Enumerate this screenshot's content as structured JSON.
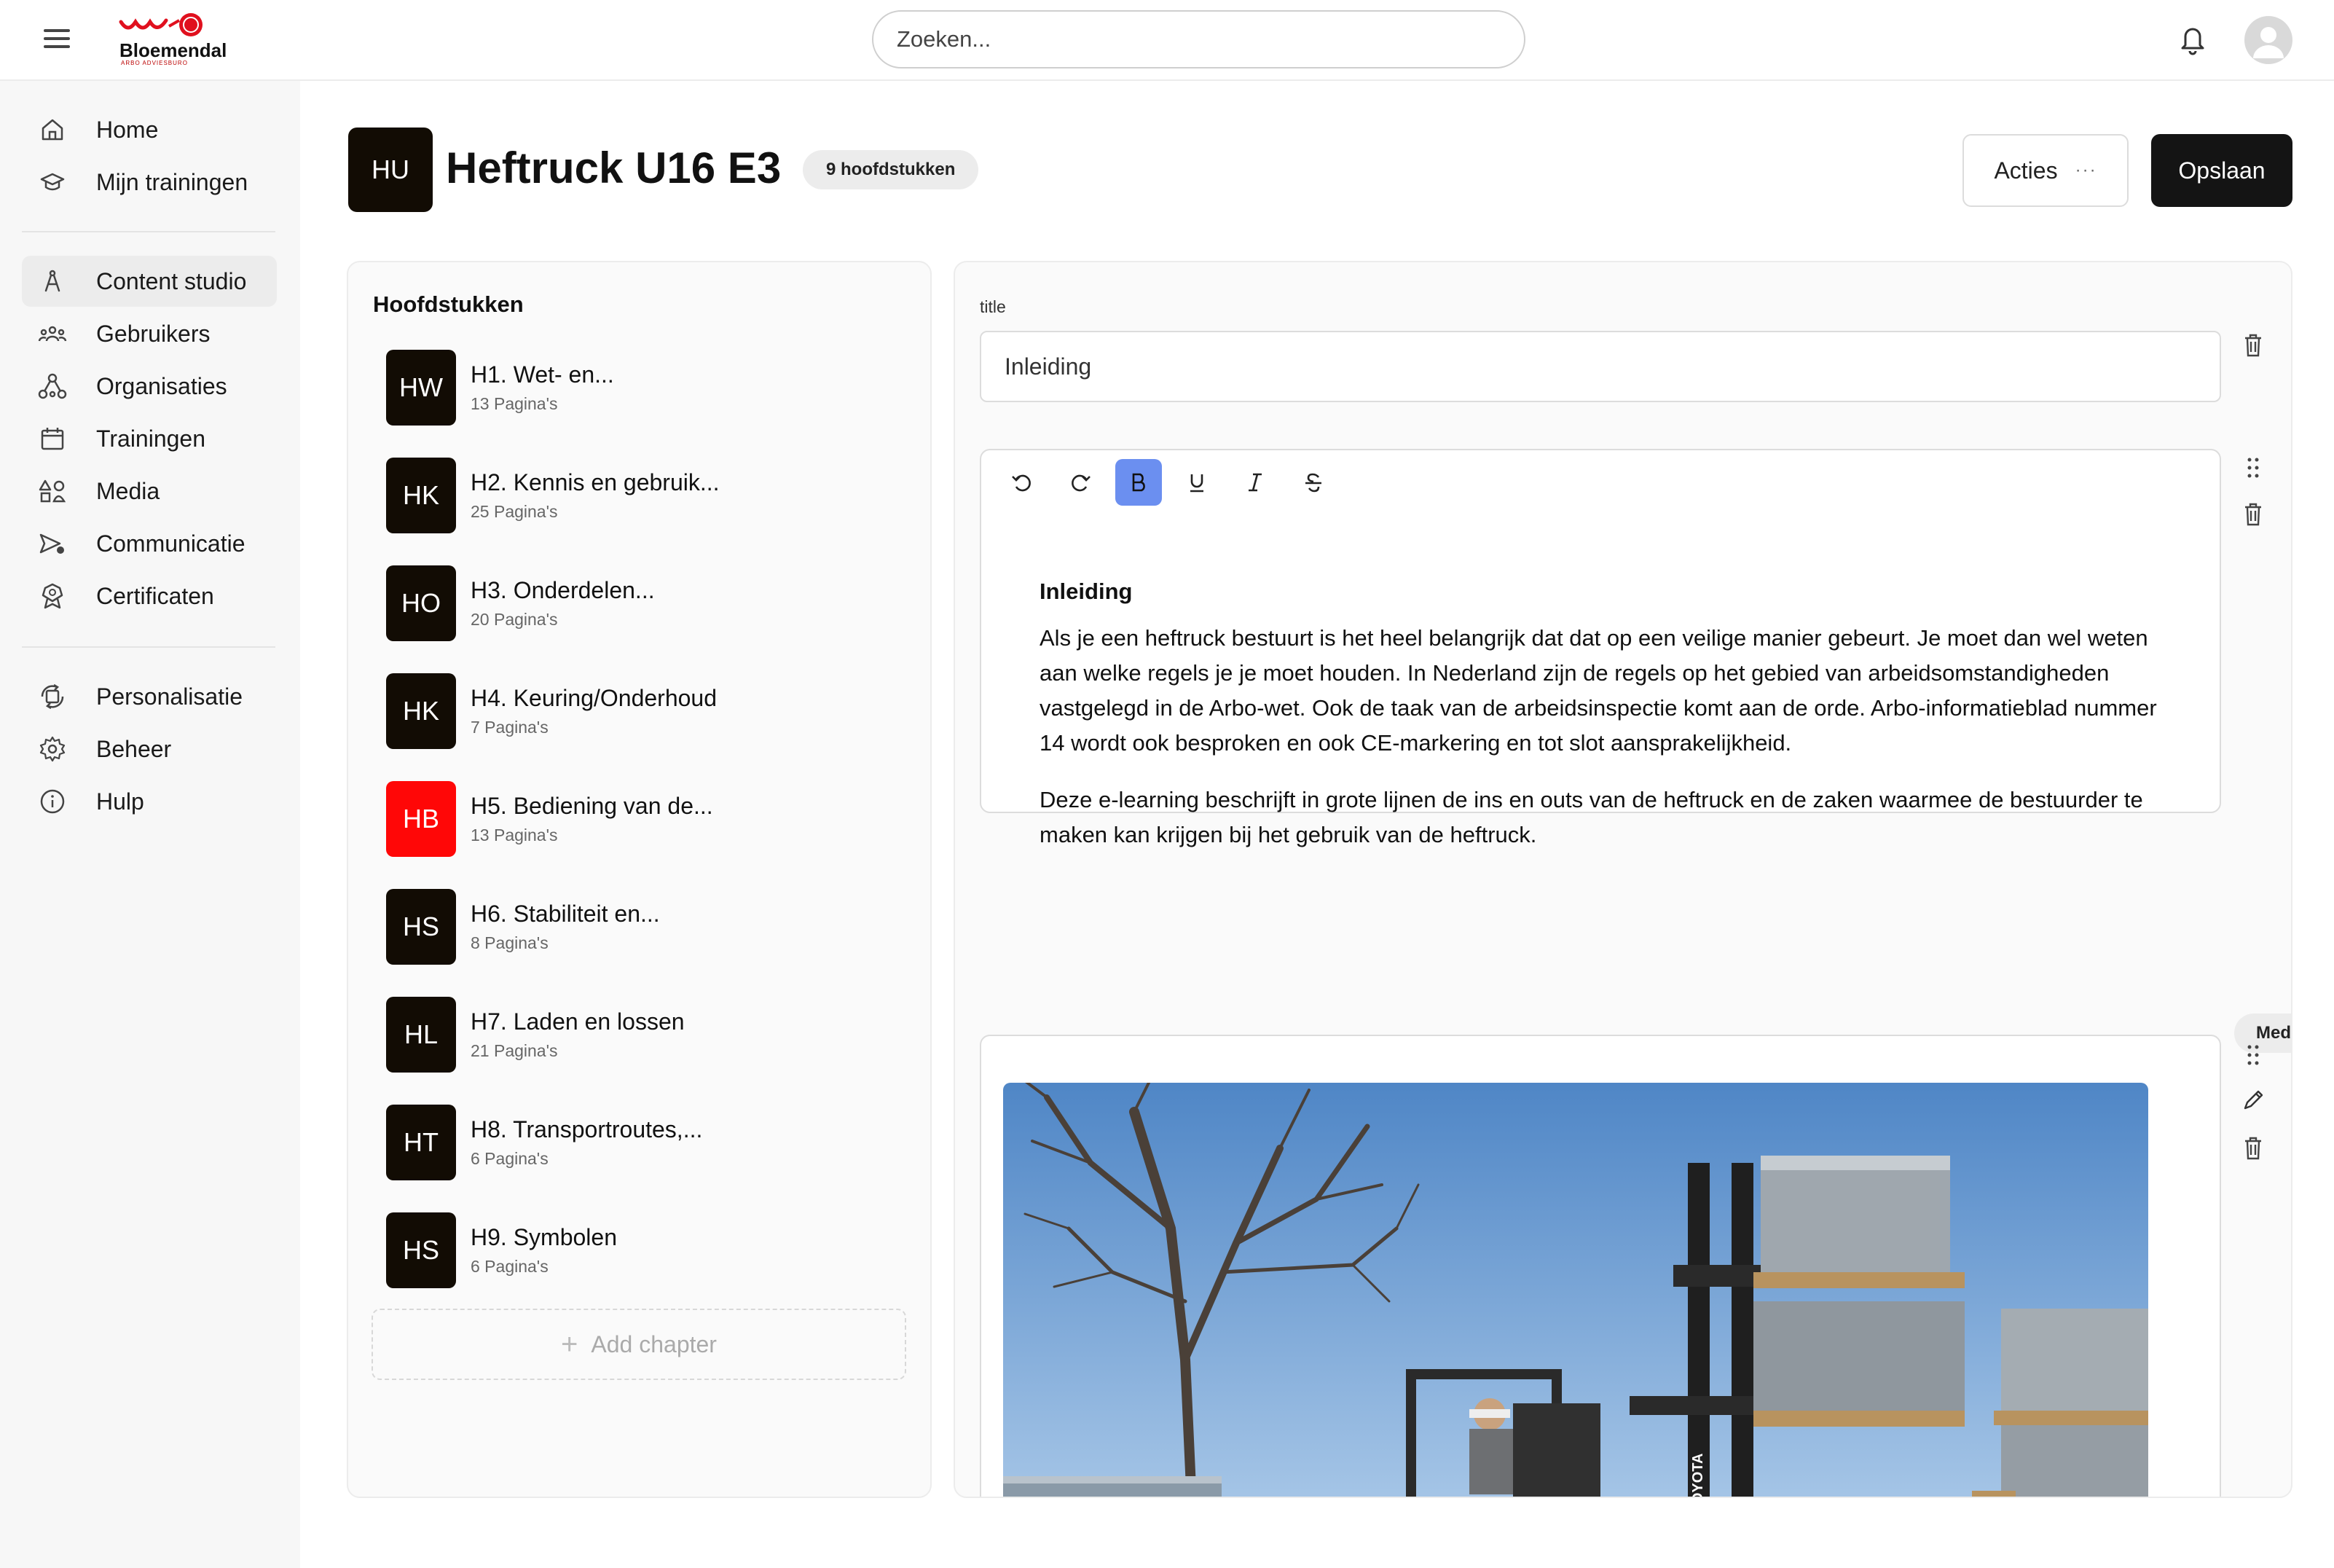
{
  "header": {
    "logo_text": "Bloemendal",
    "logo_subtext": "ARBO ADVIESBURO",
    "search_placeholder": "Zoeken...",
    "icons": [
      "menu-icon",
      "bell-icon",
      "user-avatar-icon"
    ]
  },
  "sidebar": {
    "items": [
      {
        "label": "Home",
        "icon": "home-icon"
      },
      {
        "label": "Mijn trainingen",
        "icon": "graduation-cap-icon"
      },
      {
        "label": "Content studio",
        "icon": "compass-icon",
        "active": true
      },
      {
        "label": "Gebruikers",
        "icon": "users-icon"
      },
      {
        "label": "Organisaties",
        "icon": "network-icon"
      },
      {
        "label": "Trainingen",
        "icon": "calendar-icon"
      },
      {
        "label": "Media",
        "icon": "shapes-icon"
      },
      {
        "label": "Communicatie",
        "icon": "send-icon"
      },
      {
        "label": "Certificaten",
        "icon": "award-icon"
      },
      {
        "label": "Personalisatie",
        "icon": "personalize-icon"
      },
      {
        "label": "Beheer",
        "icon": "gear-icon"
      },
      {
        "label": "Hulp",
        "icon": "info-icon"
      }
    ]
  },
  "course": {
    "initials": "HU",
    "title": "Heftruck U16 E3",
    "chapter_count": "9 hoofdstukken",
    "actions_label": "Acties",
    "save_label": "Opslaan"
  },
  "chapters": {
    "title": "Hoofdstukken",
    "items": [
      {
        "initials": "HW",
        "title": "H1. Wet- en...",
        "pages": "13 Pagina's",
        "color": "#120c04"
      },
      {
        "initials": "HK",
        "title": "H2. Kennis en gebruik...",
        "pages": "25 Pagina's",
        "color": "#120c04"
      },
      {
        "initials": "HO",
        "title": "H3. Onderdelen...",
        "pages": "20 Pagina's",
        "color": "#120c04"
      },
      {
        "initials": "HK",
        "title": "H4. Keuring/Onderhoud",
        "pages": "7 Pagina's",
        "color": "#120c04"
      },
      {
        "initials": "HB",
        "title": "H5. Bediening van de...",
        "pages": "13 Pagina's",
        "color": "#ff0707"
      },
      {
        "initials": "HS",
        "title": "H6. Stabiliteit en...",
        "pages": "8 Pagina's",
        "color": "#120c04"
      },
      {
        "initials": "HL",
        "title": "H7. Laden en lossen",
        "pages": "21 Pagina's",
        "color": "#120c04"
      },
      {
        "initials": "HT",
        "title": "H8. Transportroutes,...",
        "pages": "6 Pagina's",
        "color": "#120c04"
      },
      {
        "initials": "HS",
        "title": "H9. Symbolen",
        "pages": "6 Pagina's",
        "color": "#120c04"
      }
    ],
    "add_label": "Add chapter"
  },
  "editor": {
    "field_label": "title",
    "title_value": "Inleiding",
    "toolbar": [
      "undo-icon",
      "redo-icon",
      "bold-icon",
      "underline-icon",
      "italic-icon",
      "strikethrough-icon"
    ],
    "content_heading": "Inleiding",
    "paragraph1": "Als je een heftruck bestuurt is het heel belangrijk dat dat op een veilige manier gebeurt. Je moet dan wel weten aan welke regels je je moet houden. In Nederland zijn de regels op het gebied van arbeidsomstandigheden vastgelegd in de Arbo-wet. Ook de taak van de arbeidsinspectie komt aan de orde. Arbo-informatieblad nummer 14 wordt ook besproken en ook CE-markering  en tot slot aansprakelijkheid.",
    "paragraph2": "Deze e-learning beschrijft in grote lijnen de ins en outs van de heftruck en de zaken waarmee de bestuurder te maken kan krijgen bij het gebruik van de heftruck.",
    "media_label": "Media",
    "forklift_brand": "TOYOTA"
  }
}
